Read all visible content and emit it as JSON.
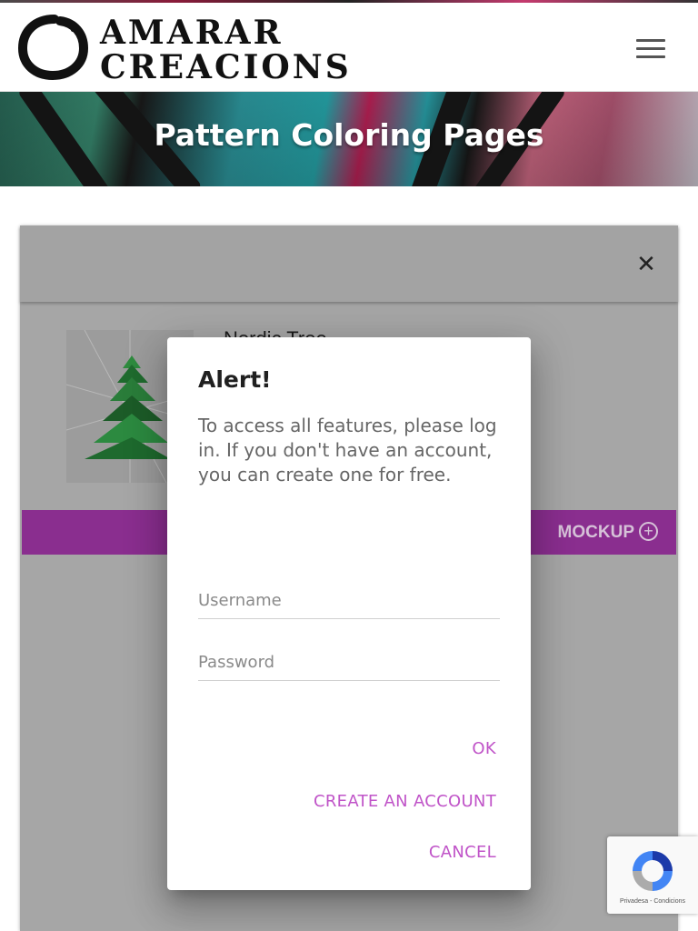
{
  "header": {
    "logo_line1": "AMARAR",
    "logo_line2": "CREACIONS",
    "menu_icon": "hamburger-menu-icon"
  },
  "banner": {
    "title": "Pattern Coloring Pages"
  },
  "panel": {
    "close_label": "✕",
    "item_title": "Nordic Tree",
    "mockup_label": "MOCKUP",
    "mockup_icon": "plus-circle-icon",
    "mockup_color": "#8a2e8f"
  },
  "dialog": {
    "title": "Alert!",
    "message": "To access all features, please log in. If you don't have an account, you can create one for free.",
    "username_placeholder": "Username",
    "password_placeholder": "Password",
    "ok_label": "OK",
    "create_label": "CREATE AN ACCOUNT",
    "cancel_label": "CANCEL",
    "accent_color": "#c054c8"
  },
  "recaptcha": {
    "links": "Privadesa - Condicions",
    "icon": "recaptcha-logo-icon"
  }
}
